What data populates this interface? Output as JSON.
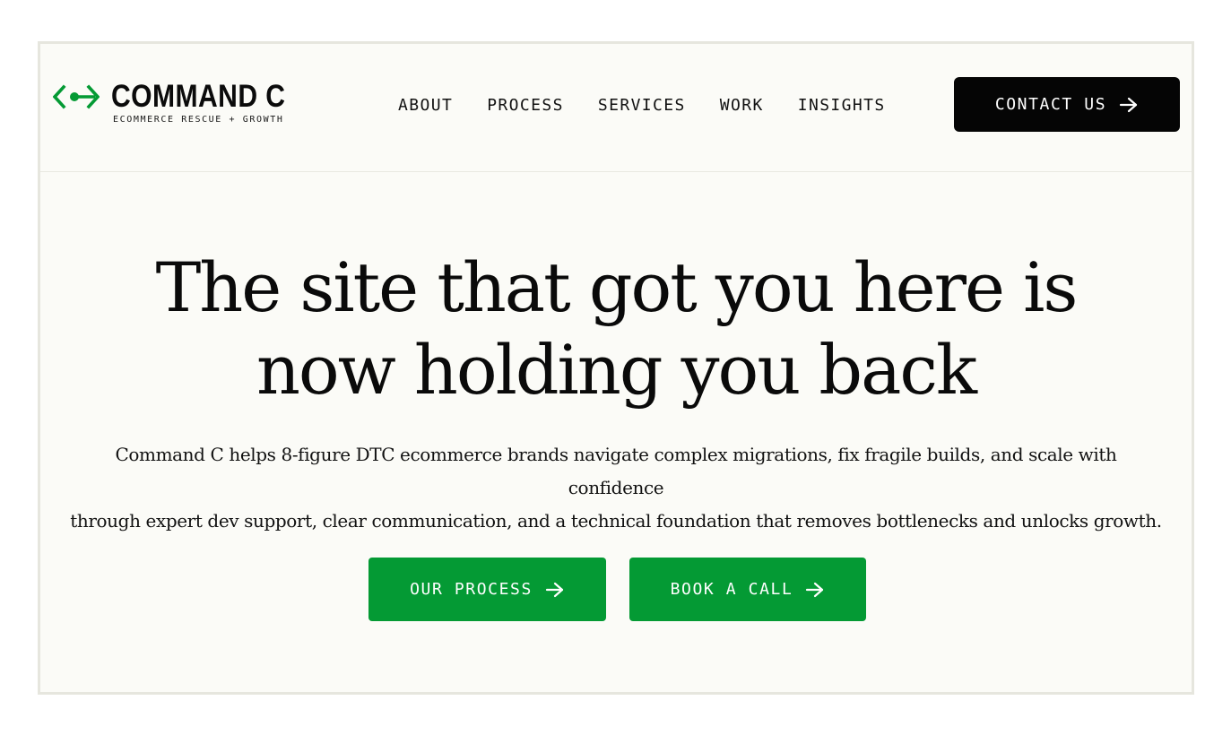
{
  "brand": {
    "name": "COMMAND C",
    "tagline": "ECOMMERCE RESCUE + GROWTH",
    "mark_icon": "code-bracket-arrow-icon",
    "accent_color": "#049a34"
  },
  "nav": {
    "items": [
      {
        "label": "ABOUT"
      },
      {
        "label": "PROCESS"
      },
      {
        "label": "SERVICES"
      },
      {
        "label": "WORK"
      },
      {
        "label": "INSIGHTS"
      }
    ],
    "contact_label": "CONTACT US",
    "contact_icon": "arrow-right-icon"
  },
  "hero": {
    "title_line1": "The site that got you here is",
    "title_line2": "now holding you back",
    "description_line1": "Command C helps 8-figure DTC ecommerce brands navigate complex migrations, fix fragile builds, and scale with confidence",
    "description_line2": "through expert dev support, clear communication, and a technical foundation that removes bottlenecks and unlocks growth.",
    "cta_primary_label": "OUR PROCESS",
    "cta_secondary_label": "BOOK A CALL",
    "cta_icon": "arrow-right-icon"
  },
  "colors": {
    "background": "#fbfbf7",
    "frame_border": "#e6e6de",
    "text": "#0a0a0a",
    "contact_button": "#050505",
    "cta_button": "#049a34"
  }
}
